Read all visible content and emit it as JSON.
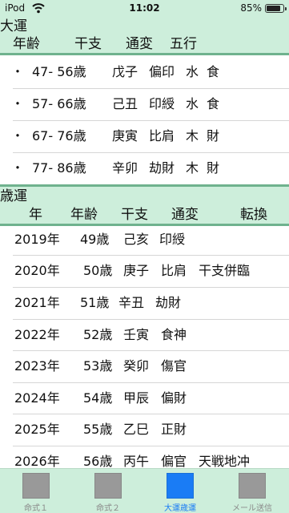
{
  "status_bar": {
    "carrier": "iPod",
    "time": "11:02",
    "battery": "85%",
    "battery_level": 0.85
  },
  "major_luck": {
    "title": "大運",
    "columns": [
      "年齢",
      "干支",
      "通変",
      "五行"
    ],
    "rows": [
      {
        "bullet": "・",
        "age": "47- 56歳",
        "kanshi": "戊子",
        "tsuhen": "偏印",
        "gogyo": "水",
        "extra": "食"
      },
      {
        "bullet": "・",
        "age": "57- 66歳",
        "kanshi": "己丑",
        "tsuhen": "印綬",
        "gogyo": "水",
        "extra": "食"
      },
      {
        "bullet": "・",
        "age": "67- 76歳",
        "kanshi": "庚寅",
        "tsuhen": "比肩",
        "gogyo": "木",
        "extra": "財"
      },
      {
        "bullet": "・",
        "age": "77- 86歳",
        "kanshi": "辛卯",
        "tsuhen": "劫財",
        "gogyo": "木",
        "extra": "財"
      }
    ]
  },
  "yearly_luck": {
    "title": "歳運",
    "columns": [
      "年",
      "年齢",
      "干支",
      "通変",
      "転換"
    ],
    "rows": [
      {
        "year": "2019年",
        "age": "49歳",
        "kanshi": "己亥",
        "tsuhen": "印綬",
        "note": ""
      },
      {
        "year": "2020年",
        "age": "50歳",
        "kanshi": "庚子",
        "tsuhen": "比肩",
        "note": "干支併臨"
      },
      {
        "year": "2021年",
        "age": "51歳",
        "kanshi": "辛丑",
        "tsuhen": "劫財",
        "note": ""
      },
      {
        "year": "2022年",
        "age": "52歳",
        "kanshi": "壬寅",
        "tsuhen": "食神",
        "note": ""
      },
      {
        "year": "2023年",
        "age": "53歳",
        "kanshi": "癸卯",
        "tsuhen": "傷官",
        "note": ""
      },
      {
        "year": "2024年",
        "age": "54歳",
        "kanshi": "甲辰",
        "tsuhen": "偏財",
        "note": ""
      },
      {
        "year": "2025年",
        "age": "55歳",
        "kanshi": "乙巳",
        "tsuhen": "正財",
        "note": ""
      },
      {
        "year": "2026年",
        "age": "56歳",
        "kanshi": "丙午",
        "tsuhen": "偏官",
        "note": "天戦地冲"
      }
    ]
  },
  "tabs": [
    {
      "label": "命式１",
      "active": false,
      "icon": "placeholder-square-icon"
    },
    {
      "label": "命式２",
      "active": false,
      "icon": "placeholder-square-icon"
    },
    {
      "label": "大運歳運",
      "active": true,
      "icon": "placeholder-square-icon"
    },
    {
      "label": "メール送信",
      "active": false,
      "icon": "placeholder-square-icon"
    }
  ],
  "colors": {
    "header_bg": "#cdeedb",
    "divider": "#6fb28e",
    "active_tab": "#1a7cf5",
    "inactive_tab": "#999999"
  }
}
